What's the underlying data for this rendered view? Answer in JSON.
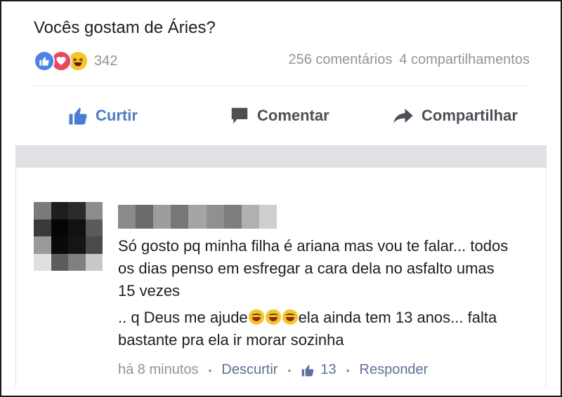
{
  "post": {
    "text": "Vocês gostam de Áries?",
    "reaction_icons": [
      "like-icon",
      "love-icon",
      "haha-icon"
    ],
    "reaction_count": "342",
    "comments_count": "256 comentários",
    "shares_count": "4 compartilhamentos"
  },
  "actions": {
    "like_label": "Curtir",
    "comment_label": "Comentar",
    "share_label": "Compartilhar"
  },
  "comment": {
    "line1": "Só gosto pq minha filha é ariana mas vou te falar... todos os dias penso em esfregar a cara dela no asfalto umas 15 vezes",
    "line2_start": ".. q Deus me ajude",
    "line2_end": "ela ainda tem 13 anos... falta bastante pra ela ir morar sozinha",
    "emoji": "grinning-tears-icon",
    "time": "há 8 minutos",
    "unlike_label": "Descurtir",
    "likes": "13",
    "reply_label": "Responder"
  },
  "colors": {
    "accent": "#4b7bd6",
    "text": "#1c1e21",
    "muted": "#90949c",
    "band": "#dfe1e5"
  }
}
